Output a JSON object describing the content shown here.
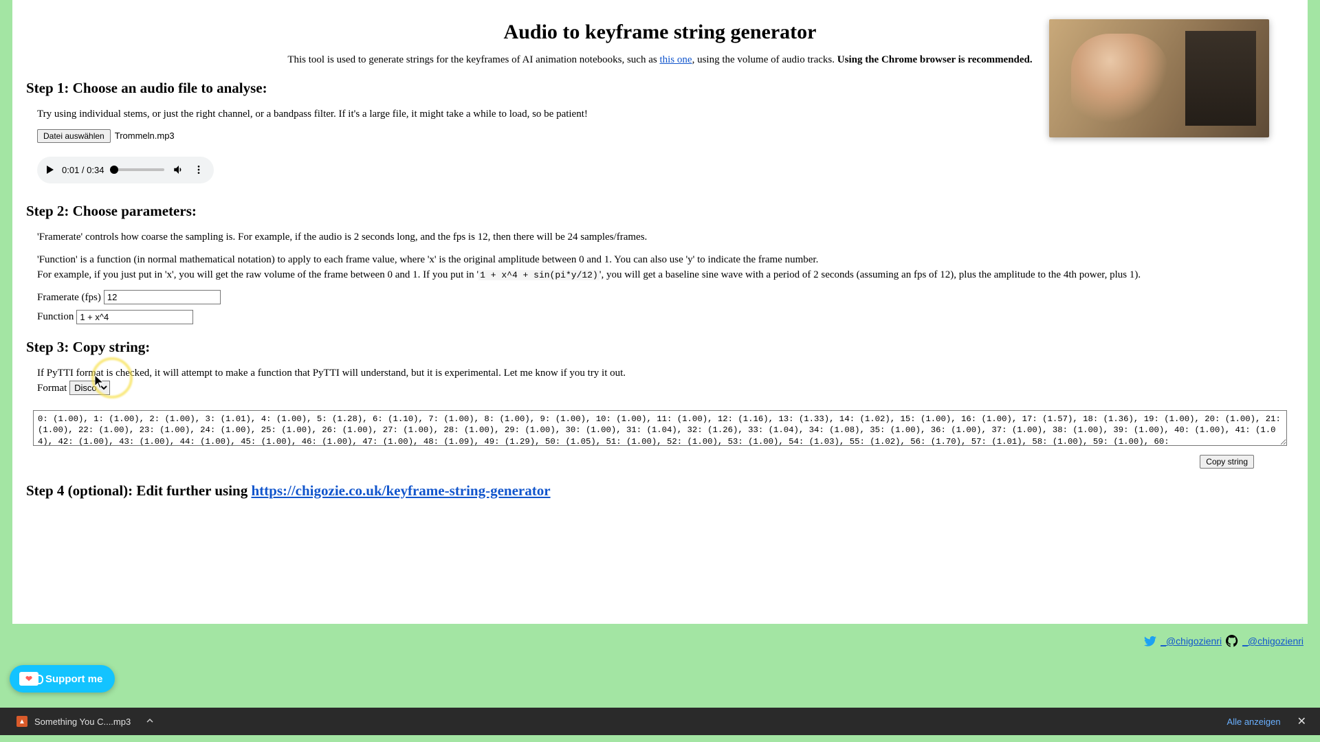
{
  "title": "Audio to keyframe string generator",
  "subtitle": {
    "prefix": "This tool is used to generate strings for the keyframes of AI animation notebooks, such as ",
    "link_text": "this one",
    "suffix": ", using the volume of audio tracks. ",
    "bold": "Using the Chrome browser is recommended."
  },
  "step1": {
    "heading": "Step 1: Choose an audio file to analyse:",
    "hint": "Try using individual stems, or just the right channel, or a bandpass filter. If it's a large file, it might take a while to load, so be patient!",
    "file_button": "Datei auswählen",
    "file_name": "Trommeln.mp3",
    "audio": {
      "time": "0:01 / 0:34"
    }
  },
  "step2": {
    "heading": "Step 2: Choose parameters:",
    "p1": "'Framerate' controls how coarse the sampling is. For example, if the audio is 2 seconds long, and the fps is 12, then there will be 24 samples/frames.",
    "p2a": "'Function' is a function (in normal mathematical notation) to apply to each frame value, where 'x' is the original amplitude between 0 and 1. You can also use 'y' to indicate the frame number.",
    "p2b_pre": "For example, if you just put in 'x', you will get the raw volume of the frame between 0 and 1. If you put in '",
    "p2b_code": "1 + x^4 + sin(pi*y/12)",
    "p2b_post": "', you will get a baseline sine wave with a period of 2 seconds (assuming an fps of 12), plus the amplitude to the 4th power, plus 1).",
    "fps_label": "Framerate (fps)",
    "fps_value": "12",
    "fn_label": "Function",
    "fn_value": "1 + x^4"
  },
  "step3": {
    "heading": "Step 3: Copy string:",
    "pytti": "If PyTTI format is checked, it will attempt to make a function that PyTTI will understand, but it is experimental. Let me know if you try it out.",
    "format_label": "Format",
    "format_value": "Disco",
    "output": "0: (1.00), 1: (1.00), 2: (1.00), 3: (1.01), 4: (1.00), 5: (1.28), 6: (1.10), 7: (1.00), 8: (1.00), 9: (1.00), 10: (1.00), 11: (1.00), 12: (1.16), 13: (1.33), 14: (1.02), 15: (1.00), 16: (1.00), 17: (1.57), 18: (1.36), 19: (1.00), 20: (1.00), 21: (1.00), 22: (1.00), 23: (1.00), 24: (1.00), 25: (1.00), 26: (1.00), 27: (1.00), 28: (1.00), 29: (1.00), 30: (1.00), 31: (1.04), 32: (1.26), 33: (1.04), 34: (1.08), 35: (1.00), 36: (1.00), 37: (1.00), 38: (1.00), 39: (1.00), 40: (1.00), 41: (1.04), 42: (1.00), 43: (1.00), 44: (1.00), 45: (1.00), 46: (1.00), 47: (1.00), 48: (1.09), 49: (1.29), 50: (1.05), 51: (1.00), 52: (1.00), 53: (1.00), 54: (1.03), 55: (1.02), 56: (1.70), 57: (1.01), 58: (1.00), 59: (1.00), 60:",
    "copy_button": "Copy string"
  },
  "step4": {
    "heading_prefix": "Step 4 (optional): Edit further using ",
    "link": "https://chigozie.co.uk/keyframe-string-generator"
  },
  "footer": {
    "twitter": "_@chigozienri",
    "github": "_@chigozienri"
  },
  "support_label": "Support me",
  "download_bar": {
    "filename": "Something You C....mp3",
    "show_all": "Alle anzeigen"
  }
}
